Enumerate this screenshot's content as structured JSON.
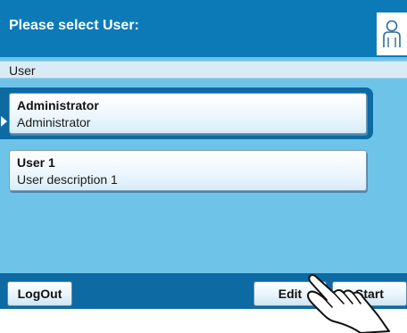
{
  "window": {
    "title": "Please select User:"
  },
  "header": {
    "icon": "user-icon",
    "column_label": "User"
  },
  "users": [
    {
      "name": "Administrator",
      "description": "Administrator",
      "selected": true
    },
    {
      "name": "User 1",
      "description": "User description 1",
      "selected": false
    }
  ],
  "footer": {
    "logout_label": "LogOut",
    "edit_label": "Edit",
    "start_label": "Start"
  },
  "overlay": {
    "icon": "pointing-hand-icon"
  },
  "colors": {
    "title_bar": "#0d7ab8",
    "background": "#6ec4e8",
    "selection": "#0d6aa3",
    "header_strip": "#d9ecf6"
  }
}
